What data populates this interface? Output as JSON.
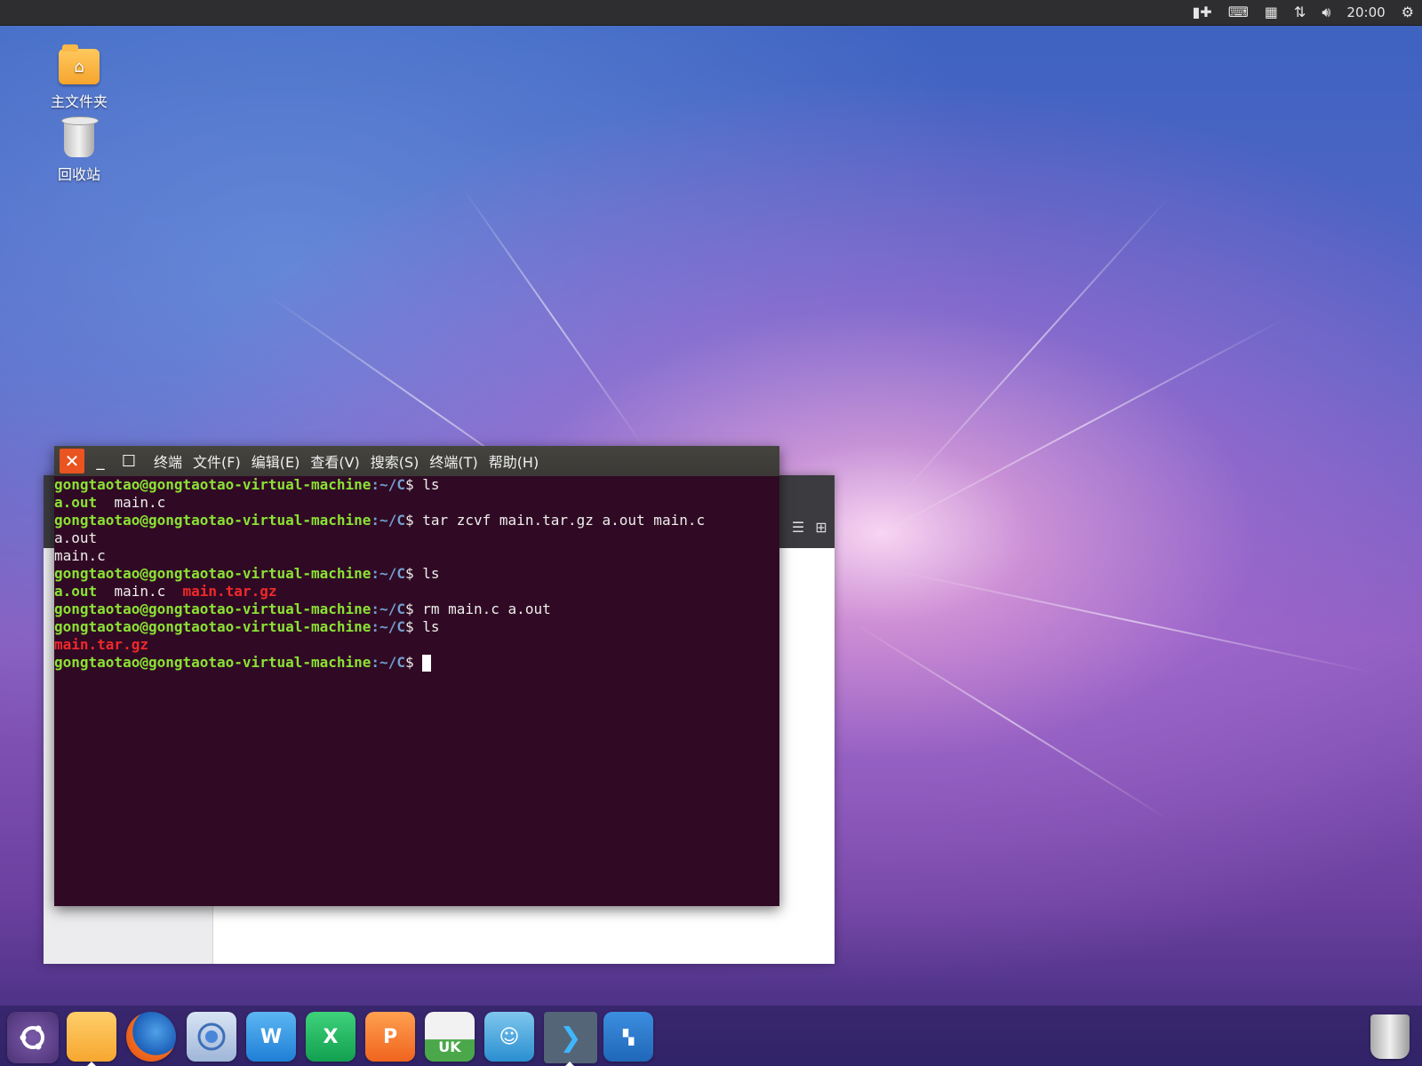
{
  "top_panel": {
    "tray_icons": [
      "network-switch-icon",
      "keyboard-icon",
      "calendar-icon",
      "transfer-icon",
      "volume-icon",
      "settings-icon"
    ],
    "clock": "20:00"
  },
  "desktop": {
    "icons": [
      {
        "label": "主文件夹",
        "icon": "home-folder-icon"
      },
      {
        "label": "回收站",
        "icon": "trash-icon"
      }
    ]
  },
  "terminal": {
    "menu": [
      "终端",
      "文件(F)",
      "编辑(E)",
      "查看(V)",
      "搜索(S)",
      "终端(T)",
      "帮助(H)"
    ],
    "prompt_user": "gongtaotao@gongtaotao-virtual-machine",
    "prompt_path": ":~/C",
    "prompt_symbol": "$ ",
    "lines": {
      "l1_cmd": "ls",
      "l2_f1": "a.out",
      "l2_f2": "  main.c",
      "l3_cmd": "tar zcvf main.tar.gz a.out main.c",
      "l4": "a.out",
      "l5": "main.c",
      "l6_cmd": "ls",
      "l7_f1": "a.out",
      "l7_f2": "  main.c  ",
      "l7_f3": "main.tar.gz",
      "l8_cmd": "rm main.c a.out",
      "l9_cmd": "ls",
      "l10": "main.tar.gz"
    }
  },
  "dock": {
    "apps": [
      "ubuntu-kylin-start",
      "file-manager",
      "firefox",
      "chromium",
      "wps-writer",
      "wps-spreadsheet",
      "wps-presentation",
      "software-center",
      "system-assistant",
      "terminal",
      "workspace-switcher"
    ],
    "labels": {
      "writer": "W",
      "spreadsheet": "X",
      "presentation": "P",
      "software_center": "UK"
    }
  },
  "colors": {
    "terminal_bg": "#300a24",
    "prompt_green": "#8ae234",
    "prompt_blue": "#729fcf",
    "archive_red": "#ef2929",
    "close_orange": "#e95420"
  }
}
